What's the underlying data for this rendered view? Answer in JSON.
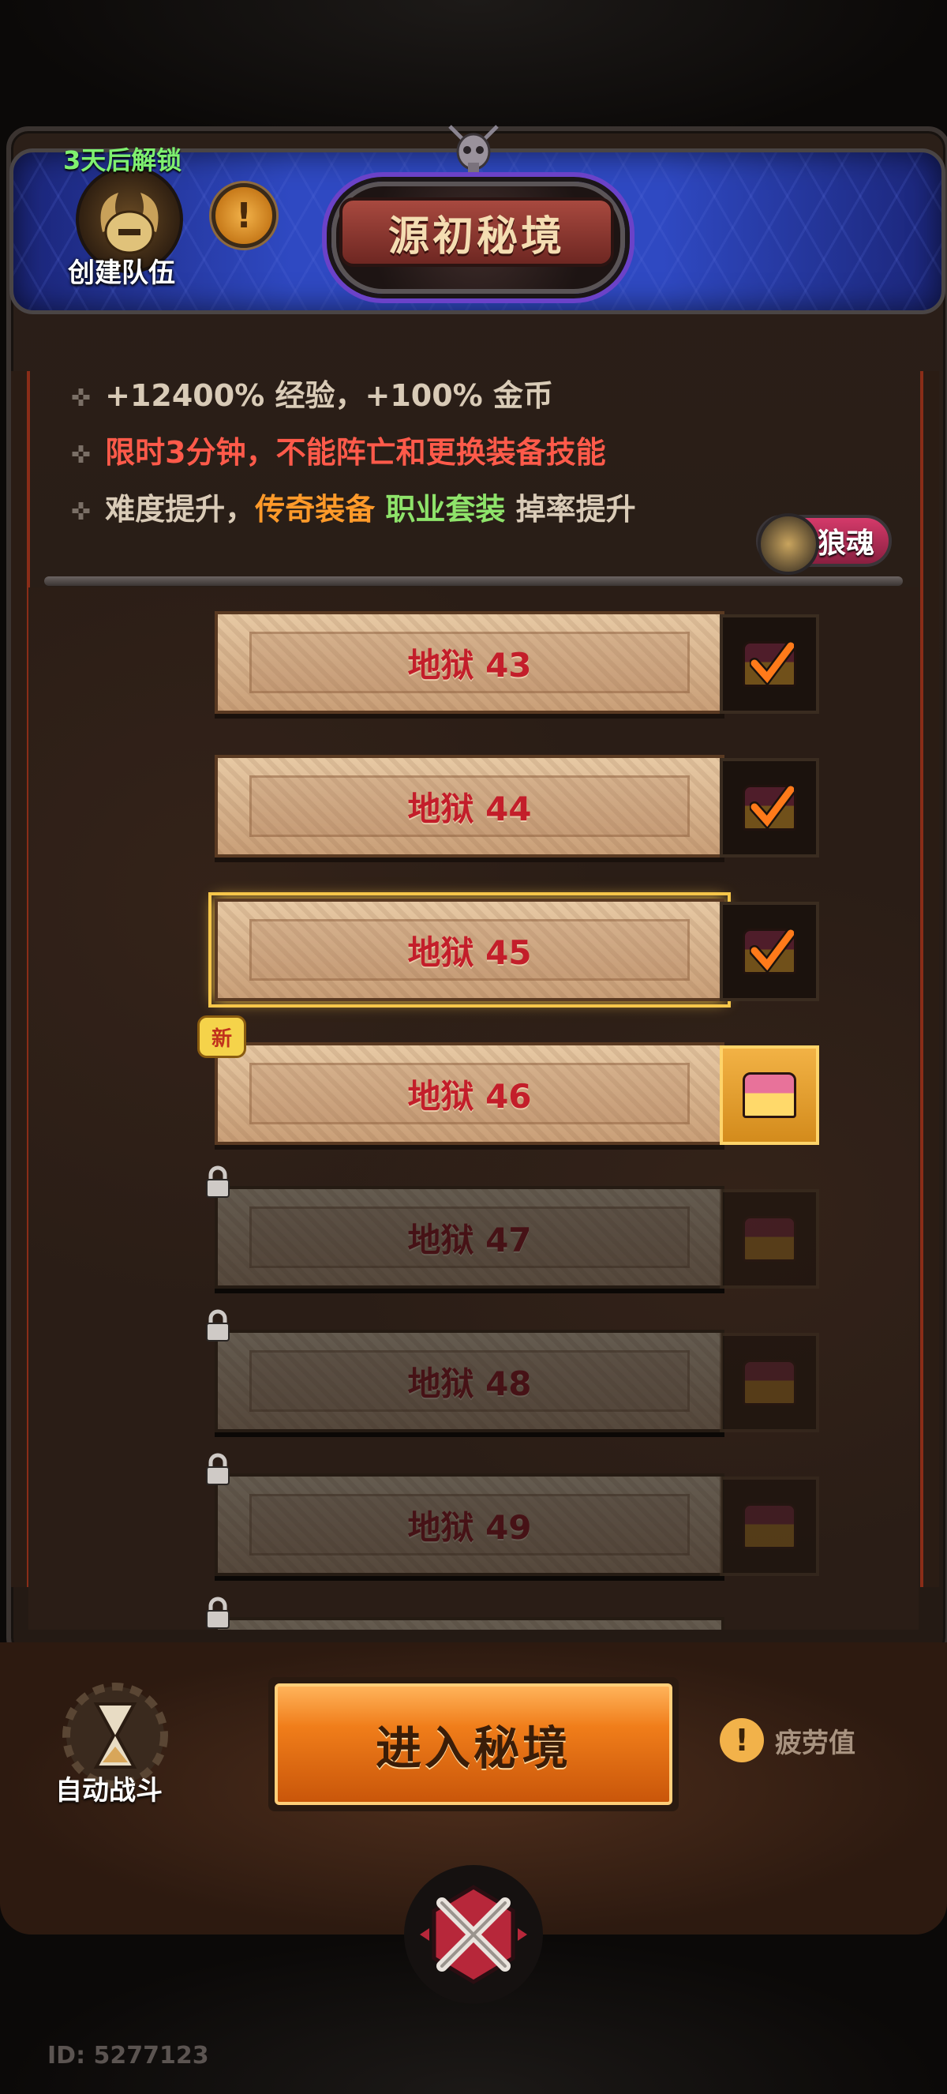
{
  "header": {
    "title": "源初秘境",
    "team_unlock": "3天后解锁",
    "team_label": "创建队伍",
    "info_badge": "!"
  },
  "rules": {
    "line1": "+12400% 经验，+100% 金币",
    "line2": "限时3分钟，不能阵亡和更换装备技能",
    "line3_prefix": "难度提升，",
    "line3_legend": "传奇装备",
    "line3_set": "职业套装",
    "line3_suffix": "掉率提升",
    "bullet": "✜"
  },
  "wolf_soul": {
    "label": "狼魂"
  },
  "levels": [
    {
      "label": "地狱 43",
      "state": "completed",
      "reward": "claimed"
    },
    {
      "label": "地狱 44",
      "state": "completed",
      "reward": "claimed"
    },
    {
      "label": "地狱 45",
      "state": "selected",
      "reward": "claimed"
    },
    {
      "label": "地狱 46",
      "state": "new",
      "reward": "claimable",
      "tag": "新"
    },
    {
      "label": "地狱 47",
      "state": "locked",
      "reward": "locked"
    },
    {
      "label": "地狱 48",
      "state": "locked",
      "reward": "locked"
    },
    {
      "label": "地狱 49",
      "state": "locked",
      "reward": "locked"
    }
  ],
  "footer": {
    "auto_battle": "自动战斗",
    "enter_button": "进入秘境",
    "fatigue_icon": "!",
    "fatigue_label": "疲劳值",
    "user_id": "ID: 5277123"
  },
  "colors": {
    "banner_blue": "#2f49c2",
    "danger_red": "#ff5a4a",
    "legend_orange": "#ff9a2a",
    "set_green": "#8ee36a",
    "unlock_green": "#7ff06f",
    "level_text_red": "#c31e2a",
    "enter_orange": "#f07d1a"
  },
  "icons": {
    "team": "horn-helmet-icon",
    "info": "exclamation-icon",
    "wolf": "wolf-head-icon",
    "reward": "treasure-chest-icon",
    "claimed": "check-mark-icon",
    "lock": "padlock-icon",
    "auto": "hourglass-gear-icon",
    "close": "crossed-swords-close-icon"
  }
}
